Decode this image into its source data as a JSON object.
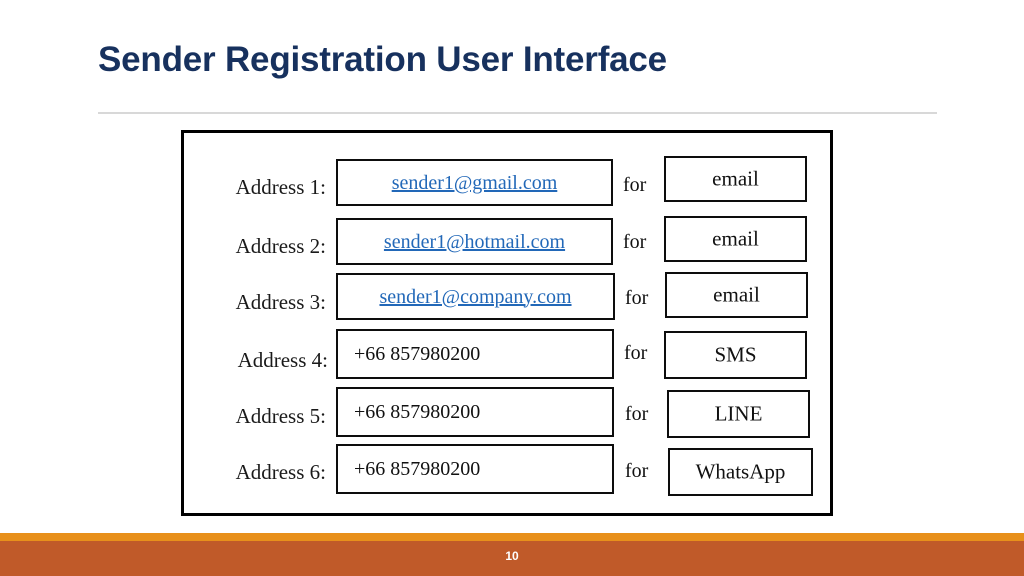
{
  "slide": {
    "title": "Sender Registration User Interface",
    "page_number": "10",
    "colors": {
      "title": "#17315E",
      "link": "#2268B8",
      "footer_stripe": "#E8901B",
      "footer_band": "#C05A29",
      "frame_border": "#000000",
      "divider": "#D8D8D8"
    }
  },
  "form": {
    "for_label": "for",
    "rows": [
      {
        "label": "Address 1:",
        "value": "sender1@gmail.com",
        "value_kind": "link",
        "type": "email"
      },
      {
        "label": "Address 2:",
        "value": "sender1@hotmail.com",
        "value_kind": "link",
        "type": "email"
      },
      {
        "label": "Address 3:",
        "value": "sender1@company.com",
        "value_kind": "link",
        "type": "email"
      },
      {
        "label": "Address 4:",
        "value": "+66 857980200",
        "value_kind": "plain",
        "type": "SMS"
      },
      {
        "label": "Address 5:",
        "value": "+66 857980200",
        "value_kind": "plain",
        "type": "LINE"
      },
      {
        "label": "Address 6:",
        "value": "+66 857980200",
        "value_kind": "plain",
        "type": "WhatsApp"
      }
    ]
  }
}
